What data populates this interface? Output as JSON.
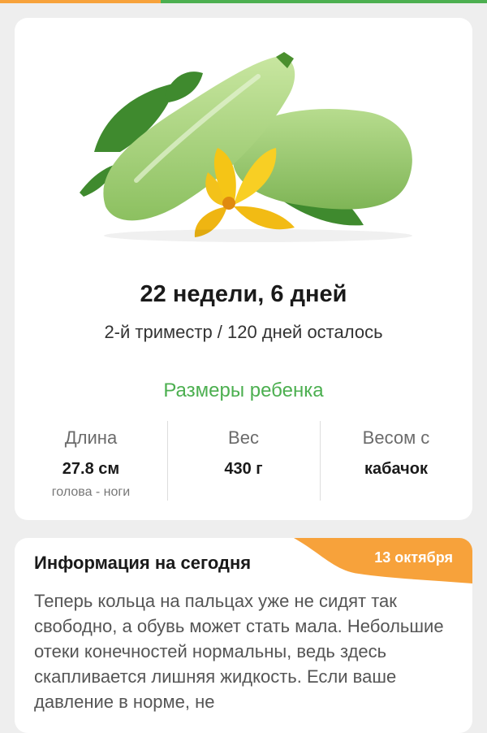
{
  "progress": {
    "fraction": 0.33,
    "fill_color": "#f7a23b",
    "track_color": "#4caf50"
  },
  "illustration": {
    "name": "zucchini-with-flower"
  },
  "week": {
    "title": "22 недели, 6 дней",
    "subtitle": "2-й триместр / 120 дней осталось"
  },
  "sizes": {
    "title": "Размеры ребенка",
    "length": {
      "label": "Длина",
      "value": "27.8 см",
      "note": "голова - ноги"
    },
    "weight": {
      "label": "Вес",
      "value": "430 г"
    },
    "compare": {
      "label": "Весом с",
      "value": "кабачок"
    }
  },
  "info": {
    "title": "Информация на сегодня",
    "date": "13 октября",
    "body": "Теперь кольца на пальцах уже не сидят так свободно, а обувь может стать мала. Небольшие отеки конечностей нормальны, ведь здесь скапливается лишняя жидкость. Если ваше давление в норме, не"
  },
  "colors": {
    "accent_green": "#4caf50",
    "accent_orange": "#f7a23b"
  }
}
